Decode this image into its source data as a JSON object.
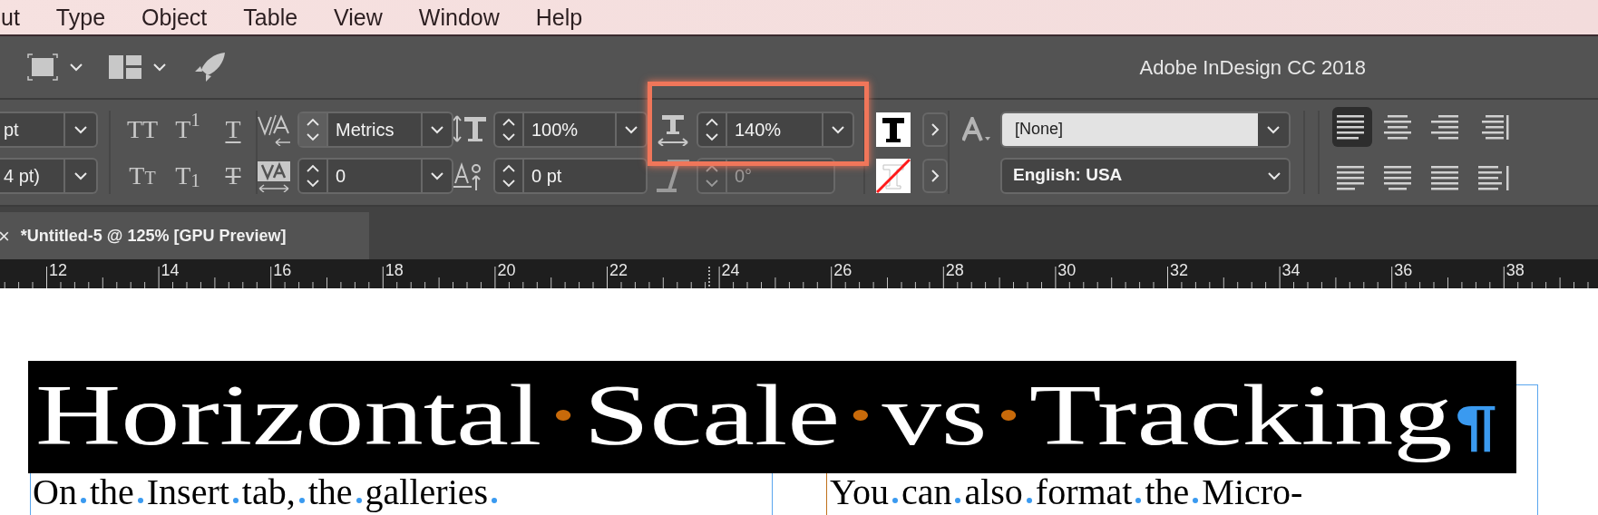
{
  "menu_bar": {
    "items": [
      "ut",
      "Type",
      "Object",
      "Table",
      "View",
      "Window",
      "Help"
    ]
  },
  "app_title": "Adobe InDesign CC 2018",
  "control_panel": {
    "size_fields": [
      {
        "value": "pt"
      },
      {
        "value": "4 pt)"
      }
    ],
    "type_styles": [
      {
        "kind": "all_caps",
        "label": "TT"
      },
      {
        "kind": "superscript",
        "label": "T$^{1}$"
      },
      {
        "kind": "underline",
        "label": "T"
      },
      {
        "kind": "small_caps",
        "label": "Tt"
      },
      {
        "kind": "subscript",
        "label": "T$_{1}$"
      },
      {
        "kind": "strikethrough",
        "label": "T"
      }
    ],
    "spin_fields": [
      {
        "kind": "kerning",
        "value": "Metrics",
        "dropdown": true,
        "disabled": false,
        "highlighted": false
      },
      {
        "kind": "tracking",
        "value": "0",
        "dropdown": true,
        "disabled": false,
        "highlighted": false
      },
      {
        "kind": "vertical_scale",
        "value": "100%",
        "dropdown": true,
        "disabled": false,
        "highlighted": false
      },
      {
        "kind": "baseline_shift",
        "value": "0 pt",
        "dropdown": false,
        "disabled": false,
        "highlighted": false
      },
      {
        "kind": "horizontal_scale",
        "value": "140%",
        "dropdown": true,
        "disabled": false,
        "highlighted": true
      },
      {
        "kind": "skew",
        "value": "0°",
        "dropdown": false,
        "disabled": true,
        "highlighted": false
      }
    ],
    "swatches": [
      {
        "kind": "fill"
      },
      {
        "kind": "stroke"
      }
    ],
    "character_style": {
      "value": "[None]"
    },
    "language": {
      "value": "English: USA"
    },
    "alignment": [
      {
        "kind": "left",
        "selected": true
      },
      {
        "kind": "center",
        "selected": false
      },
      {
        "kind": "right",
        "selected": false
      },
      {
        "kind": "towards_spine",
        "selected": false
      },
      {
        "kind": "justify_left",
        "selected": false
      },
      {
        "kind": "justify_center",
        "selected": false
      },
      {
        "kind": "justify_all",
        "selected": false
      },
      {
        "kind": "away_from_spine",
        "selected": false
      }
    ]
  },
  "document_tab": {
    "close": "×",
    "title": "*Untitled-5 @ 125% [GPU Preview]"
  },
  "ruler": {
    "labels": [
      "12",
      "14",
      "16",
      "18",
      "20",
      "22",
      "24",
      "26",
      "28",
      "30",
      "32",
      "34",
      "36",
      "38"
    ]
  },
  "canvas": {
    "headline": {
      "words": [
        "Horizontal",
        "Scale",
        "vs",
        "Tracking"
      ],
      "end_mark": "¶"
    },
    "columns": [
      {
        "words": [
          "On",
          "the",
          "Insert",
          "tab,",
          "the",
          "galleries"
        ]
      },
      {
        "words": [
          "You",
          "can",
          "also",
          "format",
          "the",
          "Micro-"
        ]
      }
    ]
  }
}
